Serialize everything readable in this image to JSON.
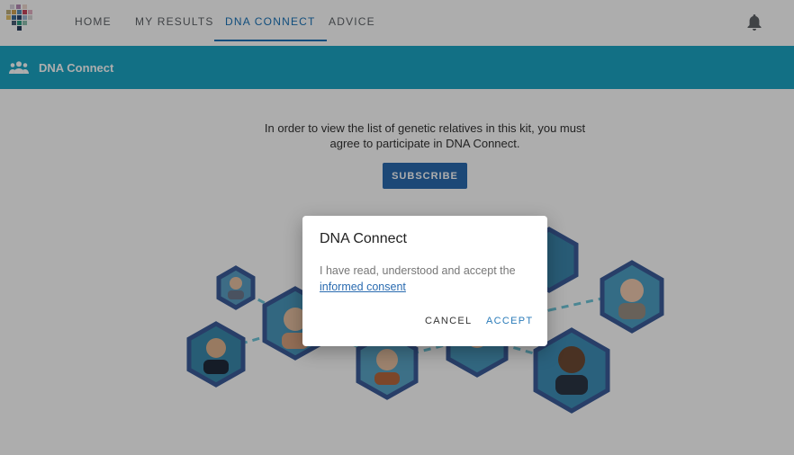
{
  "nav": {
    "items": [
      {
        "label": "HOME"
      },
      {
        "label": "MY RESULTS"
      },
      {
        "label": "DNA CONNECT"
      },
      {
        "label": "ADVICE"
      }
    ],
    "active": "DNA CONNECT"
  },
  "section": {
    "title": "DNA Connect"
  },
  "main": {
    "message": "In order to view the list of genetic relatives in this kit, you must agree to participate in DNA Connect.",
    "subscribe_label": "SUBSCRIBE"
  },
  "dialog": {
    "title": "DNA Connect",
    "body_text": "I have read, understood and accept the",
    "link_text": "informed consent",
    "cancel_label": "CANCEL",
    "accept_label": "ACCEPT"
  },
  "colors": {
    "accent": "#1a73b8",
    "section_bar": "#1ba6c5",
    "primary_button": "#2a6bb0"
  },
  "icons": {
    "notification": "bell-icon",
    "section": "people-group-icon"
  }
}
